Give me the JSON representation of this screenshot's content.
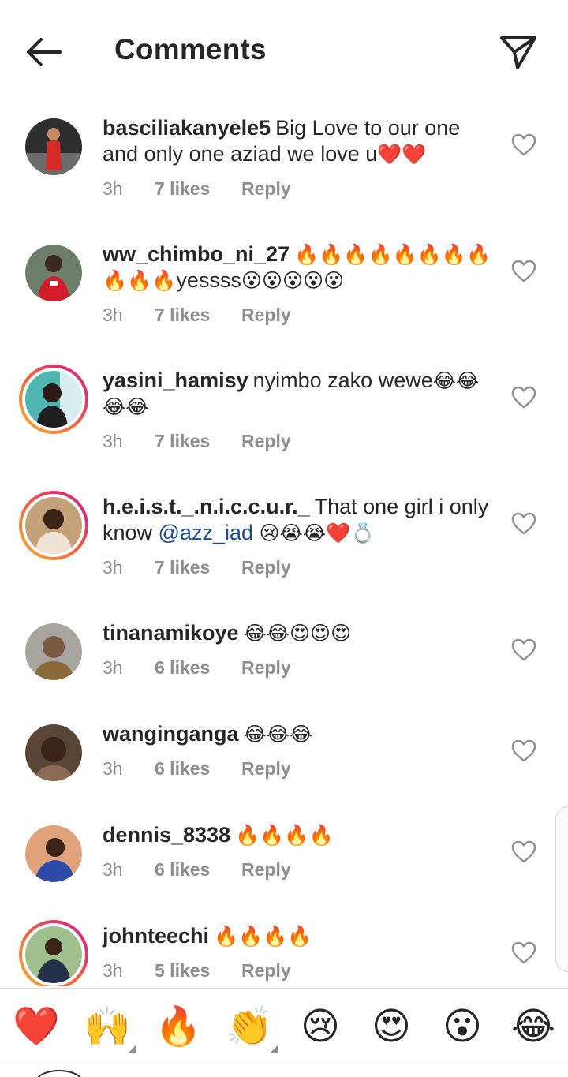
{
  "header": {
    "title": "Comments"
  },
  "comments": [
    {
      "username": "basciliakanyele5",
      "text": "Big Love to our one and only one aziad we love u",
      "emojis": "❤️❤️",
      "time": "3h",
      "likes": "7 likes",
      "reply": "Reply"
    },
    {
      "username": "ww_chimbo_ni_27",
      "text_before": "🔥🔥🔥🔥🔥🔥🔥🔥🔥🔥🔥",
      "text": "yessss",
      "emojis": "😮😮😮😮😮",
      "time": "3h",
      "likes": "7 likes",
      "reply": "Reply"
    },
    {
      "username": "yasini_hamisy",
      "text": "nyimbo zako wewe",
      "emojis": "😂😂😂😂",
      "time": "3h",
      "likes": "7 likes",
      "reply": "Reply"
    },
    {
      "username": "h.e.i.s.t._.n.i.c.c.u.r._",
      "text": "That one girl i only know",
      "mention": "@azz_iad",
      "emojis": "😢😭😭❤️💍",
      "time": "3h",
      "likes": "7 likes",
      "reply": "Reply"
    },
    {
      "username": "tinanamikoye",
      "emojis": "😂😂😍😍😍",
      "time": "3h",
      "likes": "6 likes",
      "reply": "Reply"
    },
    {
      "username": "wanginganga",
      "emojis": "😂😂😂",
      "time": "3h",
      "likes": "6 likes",
      "reply": "Reply"
    },
    {
      "username": "dennis_8338",
      "emojis": "🔥🔥🔥🔥",
      "time": "3h",
      "likes": "6 likes",
      "reply": "Reply"
    },
    {
      "username": "johnteechi",
      "emojis": "🔥🔥🔥🔥",
      "time": "3h",
      "likes": "5 likes",
      "reply": "Reply"
    }
  ],
  "emoji_bar": [
    "❤️",
    "🙌",
    "🔥",
    "👏",
    "😢",
    "😍",
    "😮",
    "😂"
  ],
  "icons": {
    "back": "arrow-left-icon",
    "send": "paper-plane-icon",
    "like": "heart-outline-icon"
  },
  "colors": {
    "text": "#262626",
    "secondary": "#8e8e8e",
    "mention": "#1a4e8a",
    "story_ring_start": "#f9b038",
    "story_ring_end": "#c1368f"
  }
}
